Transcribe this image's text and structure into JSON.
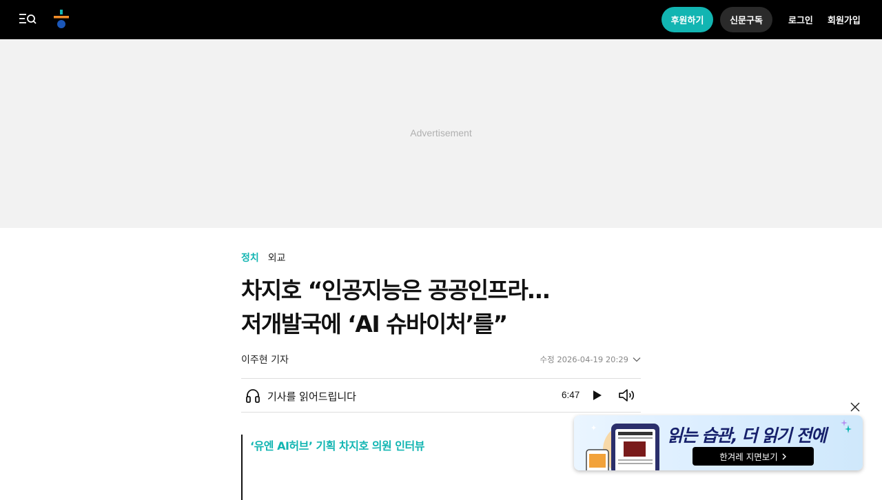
{
  "header": {
    "support_label": "후원하기",
    "subscribe_label": "신문구독",
    "login_label": "로그인",
    "signup_label": "회원가입",
    "colors": {
      "background": "#000000",
      "accent": "#12b5b2"
    }
  },
  "ad": {
    "label": "Advertisement"
  },
  "article": {
    "breadcrumb": {
      "primary": "정치",
      "secondary": "외교"
    },
    "headline_line1": "차지호 “인공지능은 공공인프라…",
    "headline_line2": "저개발국에 ‘AI 슈바이처’를”",
    "byline": "이주현 기자",
    "modified": "수정 2026-04-19 20:29",
    "tts": {
      "label": "기사를 읽어드립니다",
      "duration": "6:47"
    },
    "subhead": "‘유엔 AI허브’ 기획 차지호 의원 인터뷰"
  },
  "promo": {
    "title": "읽는 습관, 더 읽기 전에",
    "button_label": "한겨레 지면보기"
  }
}
